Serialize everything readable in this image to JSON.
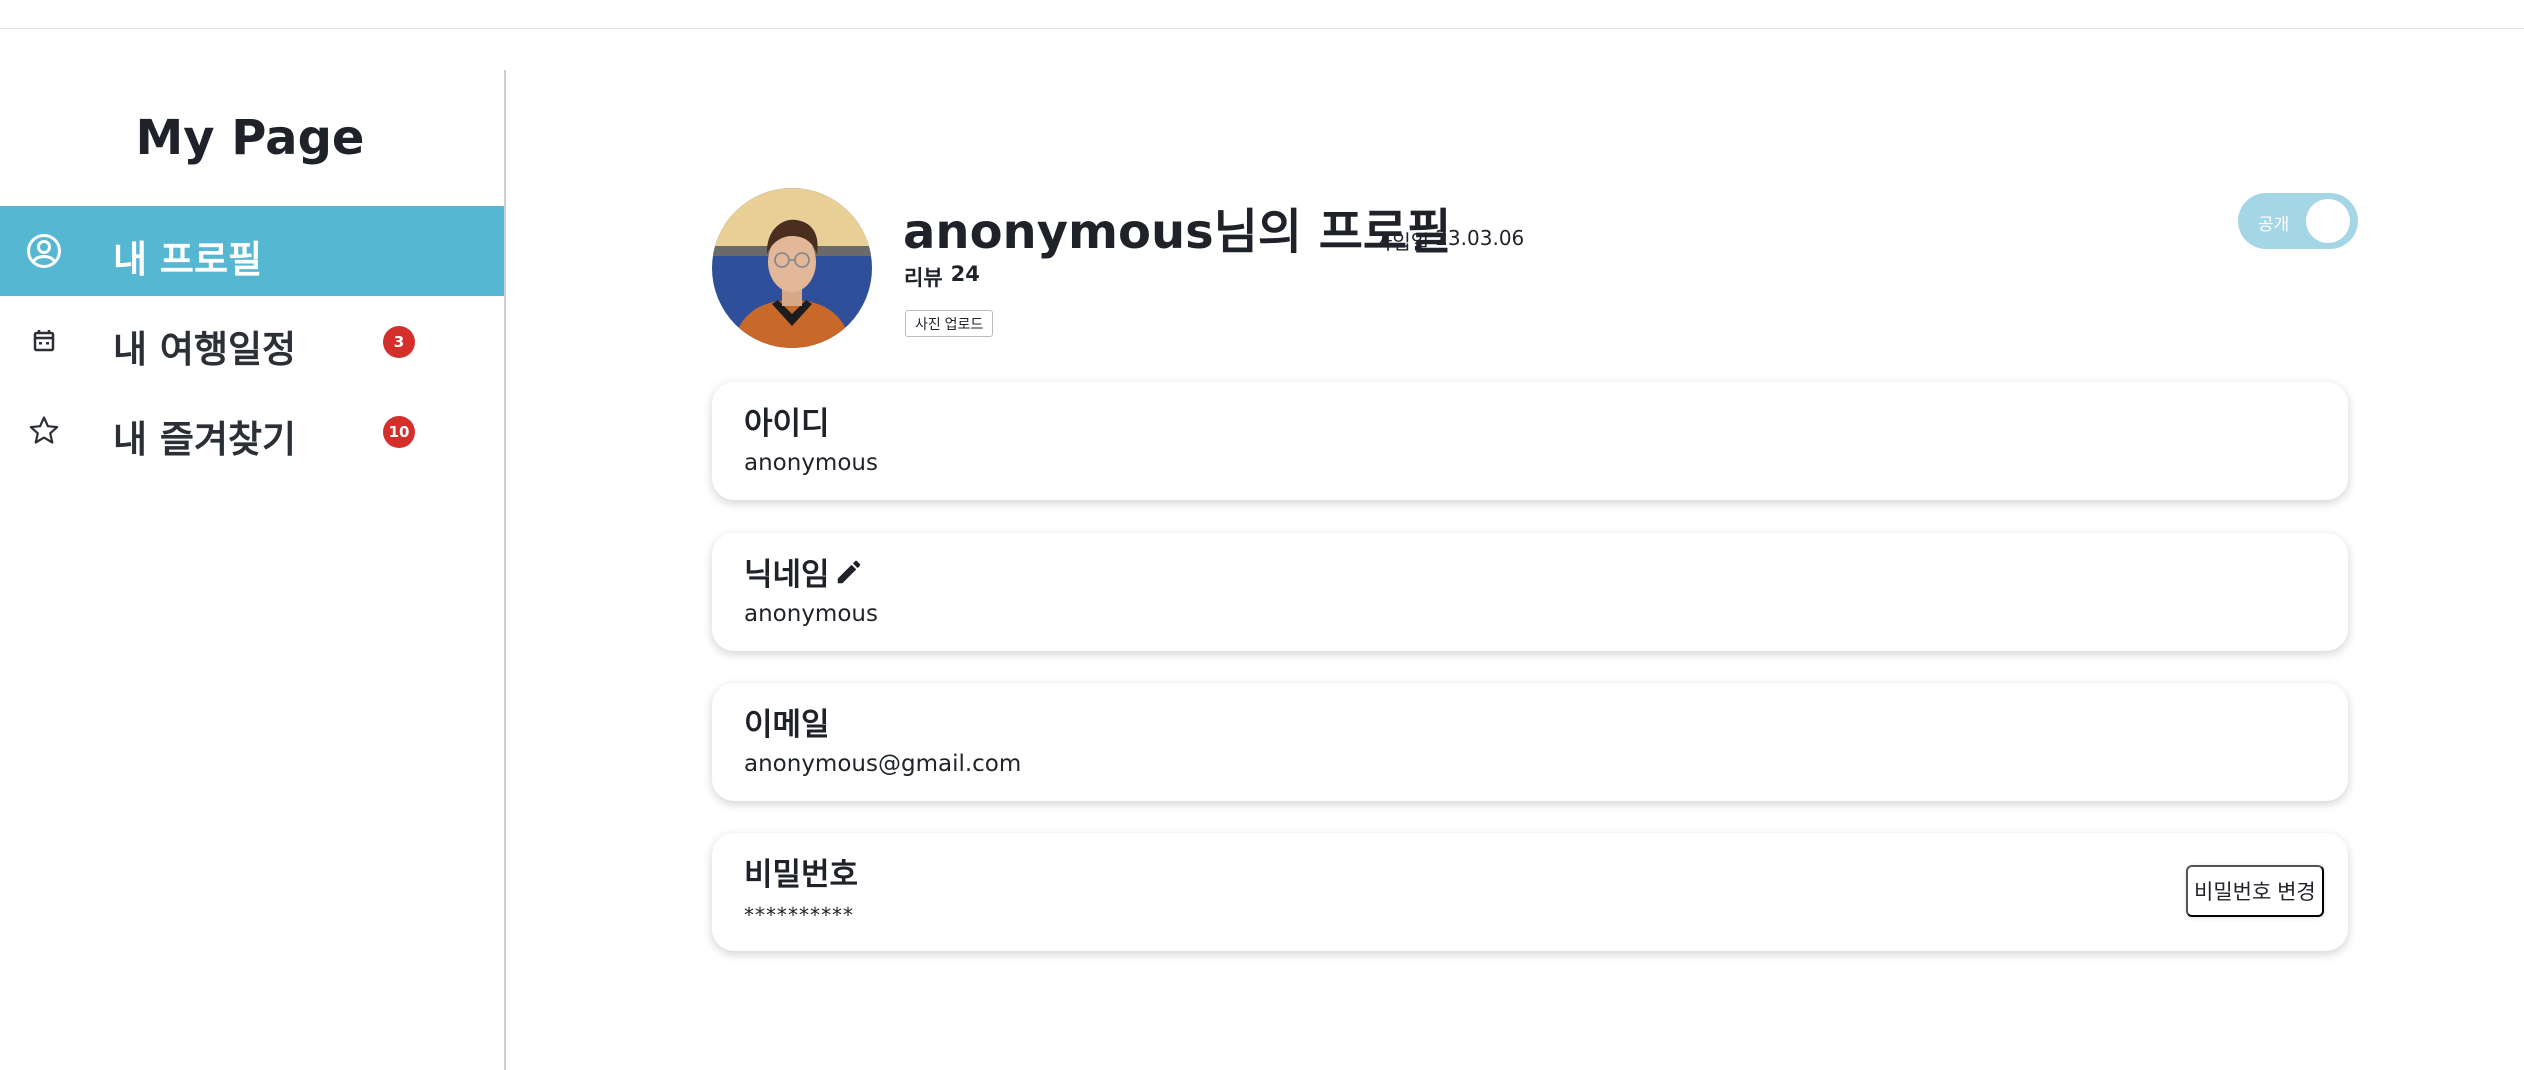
{
  "sidebar": {
    "title": "My Page",
    "items": [
      {
        "label": "내 프로필",
        "icon": "user-circle-icon",
        "active": true,
        "badge": null
      },
      {
        "label": "내 여행일정",
        "icon": "calendar-icon",
        "active": false,
        "badge": "3"
      },
      {
        "label": "내 즐겨찾기",
        "icon": "star-icon",
        "active": false,
        "badge": "10"
      }
    ],
    "active_color": "#56b7d3",
    "badge_color": "#d42f2a"
  },
  "profile": {
    "name_title": "anonymous님의 프로필",
    "join_label": "가입일",
    "join_date": "23.03.06",
    "review_label": "리뷰",
    "review_count": "24",
    "upload_button": "사진 업로드",
    "visibility_toggle": {
      "label": "공개",
      "on": true
    }
  },
  "fields": {
    "id": {
      "label": "아이디",
      "value": "anonymous"
    },
    "nickname": {
      "label": "닉네임",
      "value": "anonymous",
      "icon": "pencil-icon"
    },
    "email": {
      "label": "이메일",
      "value": "anonymous@gmail.com"
    },
    "password": {
      "label": "비밀번호",
      "value": "**********",
      "button": "비밀번호 변경"
    }
  }
}
